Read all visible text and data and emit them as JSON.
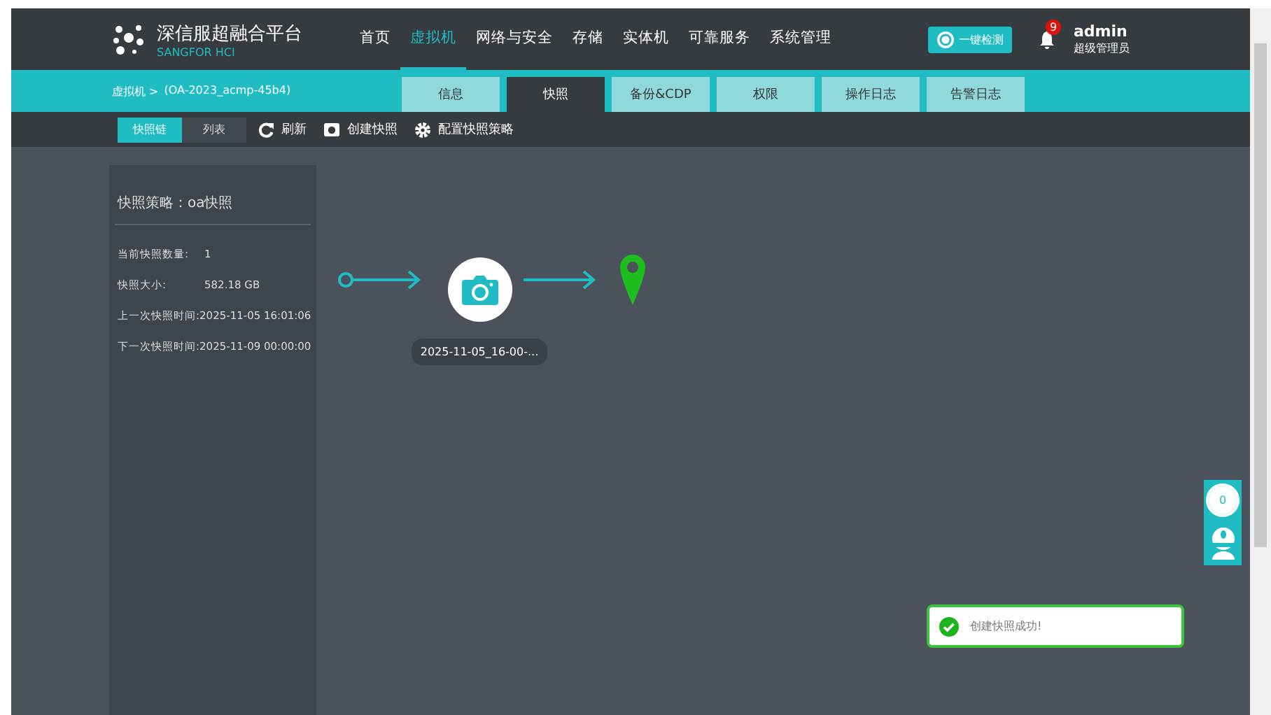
{
  "header": {
    "logo_title": "深信服超融合平台",
    "logo_subtitle": "SANGFOR HCI",
    "nav": [
      {
        "label": "首页",
        "selected": false
      },
      {
        "label": "虚拟机",
        "selected": true
      },
      {
        "label": "网络与安全",
        "selected": false
      },
      {
        "label": "存储",
        "selected": false
      },
      {
        "label": "实体机",
        "selected": false
      },
      {
        "label": "可靠服务",
        "selected": false
      },
      {
        "label": "系统管理",
        "selected": false
      }
    ],
    "check_button": "一键检测",
    "notification_count": "9",
    "user": {
      "name": "admin",
      "role": "超级管理员"
    }
  },
  "breadcrumb": {
    "parent": "虚拟机 >",
    "current": "(OA-2023_acmp-45b4)"
  },
  "tabs": [
    {
      "label": "信息",
      "selected": false
    },
    {
      "label": "快照",
      "selected": true
    },
    {
      "label": "备份&CDP",
      "selected": false
    },
    {
      "label": "权限",
      "selected": false
    },
    {
      "label": "操作日志",
      "selected": false
    },
    {
      "label": "告警日志",
      "selected": false
    }
  ],
  "toolbar": {
    "view_toggle": [
      {
        "label": "快照链",
        "selected": true
      },
      {
        "label": "列表",
        "selected": false
      }
    ],
    "actions": [
      {
        "kind": "refresh",
        "label": "刷新"
      },
      {
        "kind": "camera",
        "label": "创建快照"
      },
      {
        "kind": "gear",
        "label": "配置快照策略"
      }
    ]
  },
  "policy_panel": {
    "title": "快照策略：oa快照",
    "fields": [
      {
        "label": "当前快照数量:",
        "value": "1"
      },
      {
        "label": "快照大小:",
        "value": "582.18 GB"
      },
      {
        "label": "上一次快照时间:",
        "value": "2025-11-05 16:01:06"
      },
      {
        "label": "下一次快照时间:",
        "value": "2025-11-09 00:00:00"
      }
    ]
  },
  "snapshot_chain": {
    "snapshots": [
      {
        "label": "2025-11-05_16-00-..."
      }
    ]
  },
  "floating_tools": {
    "counter": "0"
  },
  "toast": {
    "message": "创建快照成功!"
  }
}
